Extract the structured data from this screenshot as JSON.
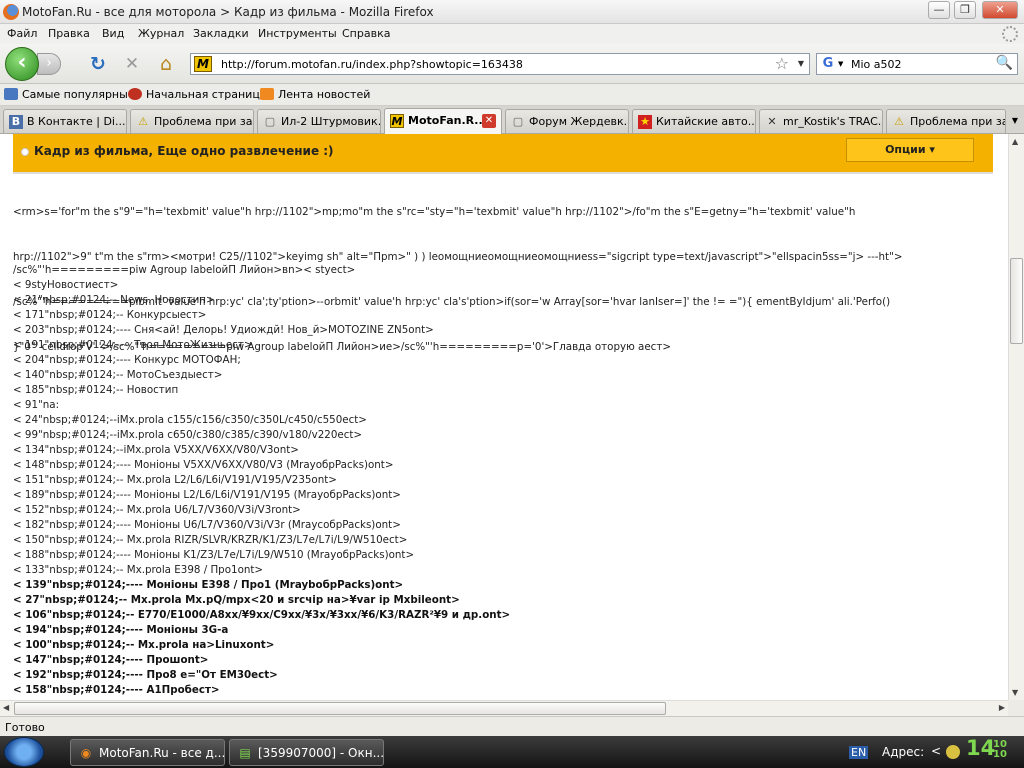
{
  "window": {
    "title": "MotoFan.Ru - все для моторола > Кадр из фильма - Mozilla Firefox",
    "controls": {
      "minimize": "—",
      "maximize": "❐",
      "close": "✕"
    }
  },
  "menu": {
    "items": [
      "Файл",
      "Правка",
      "Вид",
      "Журнал",
      "Закладки",
      "Инструменты",
      "Справка"
    ]
  },
  "navbar": {
    "back_glyph": "‹",
    "forward_glyph": "›",
    "reload_glyph": "↻",
    "stop_glyph": "✕",
    "home_glyph": "⌂",
    "url": "http://forum.motofan.ru/index.php?showtopic=163438",
    "site_icon": "M",
    "star_glyph": "☆",
    "dropdown_glyph": "▼",
    "search_engine_glyph": "G",
    "search_value": "Mio a502",
    "search_glyph": "🔍"
  },
  "bookmarks": {
    "items": [
      "Самые популярные",
      "Начальная страница",
      "Лента новостей"
    ]
  },
  "tabs": [
    {
      "label": "В Контакте | Di...",
      "icon": "В"
    },
    {
      "label": "Проблема при за...",
      "icon": "⚠"
    },
    {
      "label": "Ил-2 Штурмовик...",
      "icon": "▢"
    },
    {
      "label": "MotoFan.R...",
      "icon": "M",
      "active": true
    },
    {
      "label": "Форум Жердевк...",
      "icon": "▢"
    },
    {
      "label": "Китайские авто...",
      "icon": "★"
    },
    {
      "label": "mr_Kostik's TRAC...",
      "icon": "✕"
    },
    {
      "label": "Проблема при за...",
      "icon": "⚠"
    }
  ],
  "tab_close_glyph": "✕",
  "tabs_menu_glyph": "▼",
  "forum": {
    "topic_title": "Кадр из фильма, Еще одно развлечение :)",
    "options_label": "Опции ▾"
  },
  "code_block_1": [
    "<rm>s='for\"m the s\"9\"=\"h='texbmit' value\"h hrp://1102\">mp;mo\"m the s\"rc=\"sty=\"h='texbmit' value\"h hrp://1102\">/fo\"m the s\"E=getny=\"h='texbmit' value\"h",
    "hrp://1102\">9\" t\"m the s\"rm><мотри! C25//1102\">keyimg sh\" alt=\"Прm>\" ) ) leомощниеомощниеомощниеss=\"sigcript type=text/javascript\">\"ellspacin5ss=\"j> ---ht\">",
    "/sc%\"'h=========pibmit' value'h hrp:yc' cla';ty'ption>--orbmit' value'h hrp:yc' cla's'ption>if(sor='w Array[sor='hvar lanIser=]' the != =\"){ ementByIdjum' ali.'Perfo()",
    "}\"0\"' celldrop'V' '>/sc%\"'h=========piw Agroup labelойП Лийон>ие>/sc%\"'h=========p='0'>Главда оторую аест>"
  ],
  "code_block_2": [
    {
      "text": "/sc%\"'h=========piw Agroup labelойП Лийон>вn>< styect>",
      "bold": false
    },
    {
      "text": "< 9styНовостиест>",
      "bold": false
    },
    {
      "text": "< 21\"nbsp;#0124;-- News. Новостип>",
      "bold": false
    },
    {
      "text": "< 171\"nbsp;#0124;-- Конкурсыест>",
      "bold": false
    },
    {
      "text": "< 203\"nbsp;#0124;---- Сня<ай! Делорь! Удиождй! Нов_й>MOTOZINE ZN5ont>",
      "bold": false
    },
    {
      "text": "< 191\"nbsp;#0124;---- Твоя МотоЖизньест>",
      "bold": false
    },
    {
      "text": "< 204\"nbsp;#0124;---- Конкурс МОТОФАН;",
      "bold": false
    },
    {
      "text": "< 140\"nbsp;#0124;-- МотоСъездыест>",
      "bold": false
    },
    {
      "text": "< 185\"nbsp;#0124;-- Новостип",
      "bold": false
    },
    {
      "text": "< 91\"na:",
      "bold": false
    },
    {
      "text": "< 24\"nbsp;#0124;--iMx.prola c155/c156/c350/c350L/c450/c550ect>",
      "bold": false
    },
    {
      "text": "< 99\"nbsp;#0124;--iMx.prola c650/c380/c385/c390/v180/v220ect>",
      "bold": false
    },
    {
      "text": "< 134\"nbsp;#0124;--iMx.prola V5XX/V6XX/V80/V3ont>",
      "bold": false
    },
    {
      "text": "< 148\"nbsp;#0124;---- Моніоны V5XX/V6XX/V80/V3 (MrayобрPacks)ont>",
      "bold": false
    },
    {
      "text": "< 151\"nbsp;#0124;-- Mx.prola L2/L6/L6i/V191/V195/V235ont>",
      "bold": false
    },
    {
      "text": "< 189\"nbsp;#0124;---- Моніоны L2/L6/L6i/V191/V195 (MrayобрPacks)ont>",
      "bold": false
    },
    {
      "text": "< 152\"nbsp;#0124;-- Mx.prola U6/L7/V360/V3i/V3ront>",
      "bold": false
    },
    {
      "text": "< 182\"nbsp;#0124;---- Моніоны U6/L7/V360/V3i/V3r (MraycoбрPacks)ont>",
      "bold": false
    },
    {
      "text": "< 150\"nbsp;#0124;-- Mx.prola RIZR/SLVR/KRZR/K1/Z3/L7e/L7i/L9/W510ect>",
      "bold": false
    },
    {
      "text": "< 188\"nbsp;#0124;---- Моніоны K1/Z3/L7e/L7i/L9/W510 (MrayобрPacks)ont>",
      "bold": false
    },
    {
      "text": "< 133\"nbsp;#0124;-- Mx.prola E398 / Про1ont>",
      "bold": false
    },
    {
      "text": "< 139\"nbsp;#0124;---- Моніоны E398 / Про1 (MraybобрPacks)ont>",
      "bold": true
    },
    {
      "text": "< 27\"nbsp;#0124;-- Mx.prola Mx.pQ/mpx<20 и srcчip на>¥var ip Mxbileont>",
      "bold": true
    },
    {
      "text": "< 106\"nbsp;#0124;-- E770/E1000/A8xx/¥9xx/C9xx/¥3x/¥3xx/¥6/K3/RAZR²¥9 и др.ont>",
      "bold": true
    },
    {
      "text": "< 194\"nbsp;#0124;---- Моніоны 3G-a",
      "bold": true
    },
    {
      "text": "< 100\"nbsp;#0124;-- Mx.prola на>Linuxont>",
      "bold": true
    },
    {
      "text": "< 147\"nbsp;#0124;---- Прошont>",
      "bold": true
    },
    {
      "text": "< 192\"nbsp;#0124;---- Про8 e=\"От EM30ect>",
      "bold": true
    },
    {
      "text": "< 158\"nbsp;#0124;---- A1Пробест>",
      "bold": true
    }
  ],
  "status": {
    "text": "Готово"
  },
  "taskbar": {
    "items": [
      {
        "label": "MotoFan.Ru - все д...",
        "icon": "◉"
      },
      {
        "label": "[359907000] - Окн...",
        "icon": "▤"
      }
    ],
    "lang": "EN",
    "addr_label": "Адрес:",
    "chevron": "<",
    "clock_hours": "14",
    "clock_minutes_top": "10",
    "clock_minutes_bottom": "10"
  },
  "colors": {
    "forum_header_bg": "#f5b100",
    "options_btn_bg": "#ffc41a",
    "back_btn_green": "#2b8a1d",
    "clock_green": "#7fd84f",
    "tab_close_red": "#d03a2c"
  }
}
